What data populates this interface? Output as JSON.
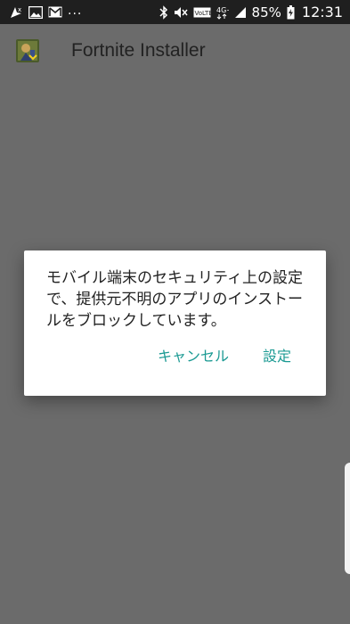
{
  "status_bar": {
    "left_icons": [
      "gps-icon",
      "image-icon",
      "gmail-icon"
    ],
    "overflow": "...",
    "right_icons": [
      "bluetooth-icon",
      "mute-icon",
      "volte-icon",
      "4g-icon",
      "signal-icon",
      "battery-icon"
    ],
    "volte_label": "VoLTE",
    "network_label": "4G+",
    "battery": "85%",
    "time": "12:31"
  },
  "app_bar": {
    "title": "Fortnite Installer",
    "icon": "fortnite-app-icon"
  },
  "dialog": {
    "message": "モバイル端末のセキュリティ上の設定で、提供元不明のアプリのインストールをブロックしています。",
    "cancel_label": "キャンセル",
    "settings_label": "設定"
  },
  "colors": {
    "status_bar": "#1f1f1f",
    "scrim": "#6b6b6b",
    "dialog_bg": "#ffffff",
    "accent": "#1b9a93"
  }
}
